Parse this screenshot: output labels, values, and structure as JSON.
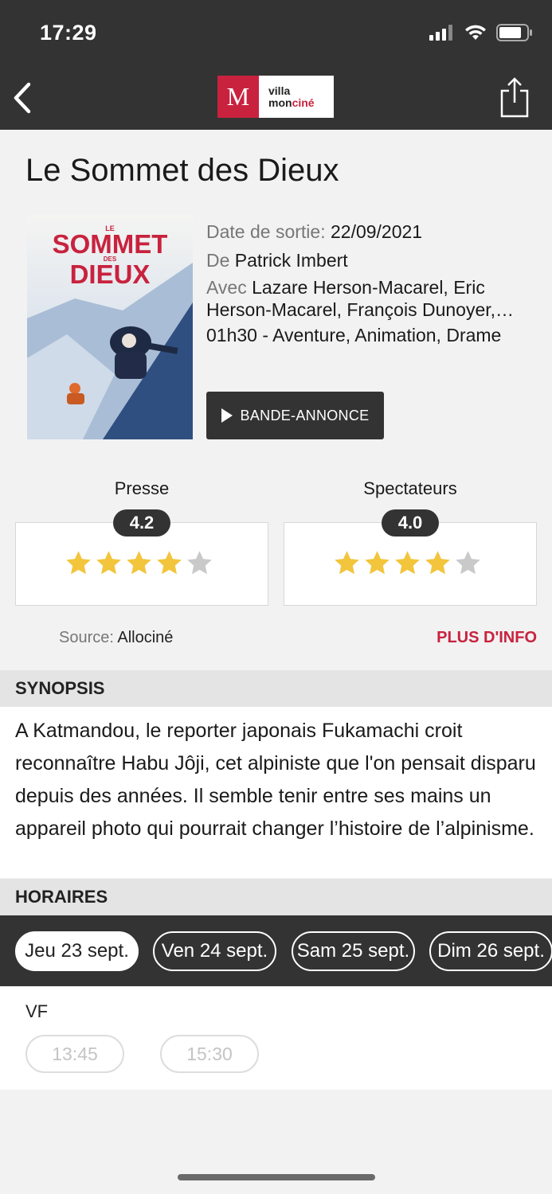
{
  "status_bar": {
    "time": "17:29"
  },
  "header": {
    "logo_mark": "M",
    "logo_line1": "villa",
    "logo_line2_a": "mon",
    "logo_line2_b": "ciné",
    "back_icon": "chevron-left-icon",
    "share_icon": "share-icon"
  },
  "movie": {
    "title": "Le Sommet des Dieux",
    "poster": {
      "line1": "LE",
      "line2": "SOMMET",
      "line3": "DES",
      "line4": "DIEUX"
    },
    "release_label": "Date de sortie:",
    "release_date": "22/09/2021",
    "director_label": "De",
    "director": "Patrick Imbert",
    "cast_label": "Avec",
    "cast": "Lazare Herson-Macarel, Eric Herson-Macarel, François Dunoyer, Pierre",
    "details": "01h30 - Aventure, Animation, Drame",
    "trailer_label": "BANDE-ANNONCE"
  },
  "ratings": {
    "press_label": "Presse",
    "press_score": "4.2",
    "press_stars_filled": 4,
    "audience_label": "Spectateurs",
    "audience_score": "4.0",
    "audience_stars_filled": 4,
    "stars_total": 5,
    "source_label": "Source:",
    "source_name": "Allociné",
    "more_info": "PLUS D'INFO"
  },
  "synopsis": {
    "heading": "SYNOPSIS",
    "text": "A Katmandou, le reporter japonais Fukamachi croit reconnaître Habu Jôji, cet alpiniste que l'on pensait disparu depuis des années. Il semble tenir entre ses mains un appareil photo qui pourrait changer l’histoire de l’alpinisme."
  },
  "schedule": {
    "heading": "HORAIRES",
    "dates": [
      "Jeu 23 sept.",
      "Ven 24 sept.",
      "Sam 25 sept.",
      "Dim 26 sept."
    ],
    "selected_date": "Jeu 23 sept.",
    "version": "VF",
    "times": [
      "13:45",
      "15:30"
    ]
  },
  "colors": {
    "accent": "#c8223e",
    "dark": "#333333",
    "star": "#f2c53d",
    "star_empty": "#c9c9c9"
  }
}
